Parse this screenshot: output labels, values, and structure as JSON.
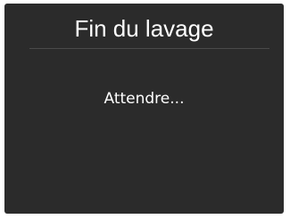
{
  "screen": {
    "title": "Fin du lavage",
    "message": "Attendre..."
  },
  "colors": {
    "background": "#2b2b2b",
    "text": "#ffffff",
    "divider": "#4a4a4a"
  }
}
